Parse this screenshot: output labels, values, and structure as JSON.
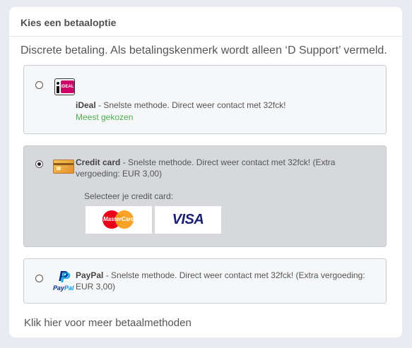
{
  "panel": {
    "title": "Kies een betaaloptie",
    "intro": "Discrete betaling. Als betalingskenmerk wordt alleen ‘D Support’ vermeld."
  },
  "options": [
    {
      "id": "ideal",
      "selected": false,
      "logo_icon": "ideal-logo-icon",
      "logo_text": "iDEAL",
      "name": "iDeal",
      "description": " - Snelste methode. Direct weer contact met 32fck!",
      "badge": "Meest gekozen",
      "badge_color": "#4caf50"
    },
    {
      "id": "creditcard",
      "selected": true,
      "logo_icon": "credit-card-icon",
      "name": "Credit card",
      "description_line1": " - Snelste methode. Direct weer contact met 32fck! (Extra",
      "description_line2": "vergoeding: EUR 3,00)",
      "sub_label": "Selecteer je credit card:",
      "cards": [
        {
          "id": "mastercard",
          "label": "MasterCard",
          "icon": "mastercard-logo-icon"
        },
        {
          "id": "visa",
          "label": "VISA",
          "icon": "visa-logo-icon"
        }
      ]
    },
    {
      "id": "paypal",
      "selected": false,
      "logo_icon": "paypal-logo-icon",
      "logo_word_a": "Pay",
      "logo_word_b": "Pal",
      "name": "PayPal",
      "description_line1": " - Snelste methode. Direct weer contact met 32fck! (Extra vergoeding:",
      "description_line2": "EUR 3,00)"
    }
  ],
  "more_link": "Klik hier voor meer betaalmethoden",
  "colors": {
    "background": "#e8ebf0",
    "selected_option": "#d6d8db",
    "option_bg": "#f6f7f9",
    "ideal_pink": "#cc0066",
    "mastercard_red": "#eb001b",
    "mastercard_yellow": "#f79e1b",
    "visa_blue": "#1a1f71",
    "paypal_dark": "#003087",
    "paypal_light": "#009cde"
  }
}
